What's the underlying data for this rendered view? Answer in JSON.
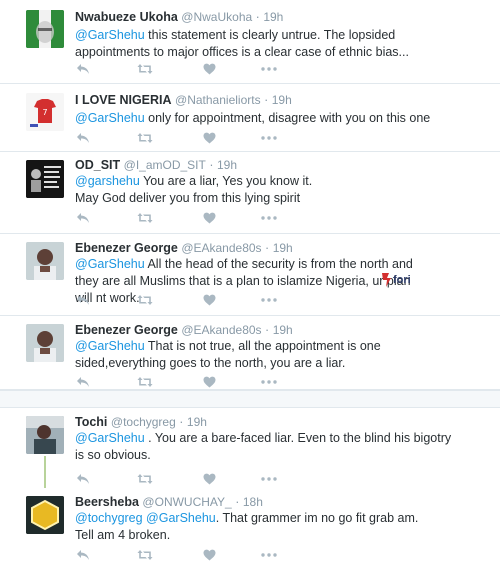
{
  "tweets": [
    {
      "name": "Nwabueze Ukoha",
      "handle": "@NwaUkoha",
      "time": "19h",
      "mention": "@GarShehu",
      "text": " this statement is clearly untrue. The lopsided appointments to major offices is a clear case of ethnic bias..."
    },
    {
      "name": "I LOVE NIGERIA",
      "handle": "@Nathanieliorts",
      "time": "19h",
      "mention": "@GarShehu",
      "text": " only for appointment, disagree with you on this one"
    },
    {
      "name": "OD_SIT",
      "handle": "@I_amOD_SIT",
      "time": "19h",
      "mention": "@garshehu",
      "text": " You are a liar, Yes you know it.",
      "text2": "May God deliver you from this lying spirit"
    },
    {
      "name": "Ebenezer George",
      "handle": "@EAkande80s",
      "time": "19h",
      "mention": "@GarShehu",
      "text": " All the head of the security is from the north and they are all Muslims that is a plan to islamize Nigeria, ur plan will nt work."
    },
    {
      "name": "Ebenezer George",
      "handle": "@EAkande80s",
      "time": "19h",
      "mention": "@GarShehu",
      "text": " That is not true, all the appointment is one sided,everything goes to the north, you are a liar."
    },
    {
      "name": "Tochi",
      "handle": "@tochygreg",
      "time": "19h",
      "mention": "@GarShehu",
      "text": " . You are a bare-faced liar. Even to the blind his bigotry is so obvious."
    },
    {
      "name": "Beersheba",
      "handle": "@ONWUCHAY_",
      "time": "18h",
      "mention": "@tochygreg @GarShehu",
      "text": ". That grammer im no go fit grab am.",
      "text2": "Tell am 4 broken."
    }
  ],
  "watermark": {
    "text": "fori"
  },
  "colors": {
    "link": "#1b95e0",
    "muted": "#8899a6",
    "border": "#e1e8ed"
  },
  "icons": [
    "reply-icon",
    "retweet-icon",
    "like-icon",
    "more-icon"
  ]
}
